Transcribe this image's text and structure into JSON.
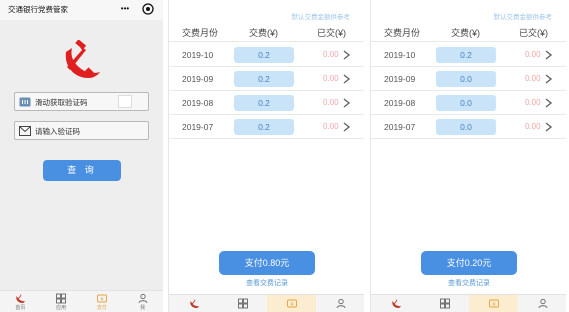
{
  "login_screen": {
    "app_title": "交通银行党费管家",
    "captcha_placeholder": "滑动获取验证码",
    "code_placeholder": "请输入验证码",
    "query_button": "查 询",
    "tabs": [
      {
        "label": "首页",
        "icon": "party-emblem-icon"
      },
      {
        "label": "应用",
        "icon": "grid-icon"
      },
      {
        "label": "支付",
        "icon": "payment-icon",
        "active": true
      },
      {
        "label": "我",
        "icon": "person-icon"
      }
    ]
  },
  "fee_list_1": {
    "notice": "默认交费金额供参考",
    "headers": {
      "month": "交费月份",
      "fee": "交费(¥)",
      "paid": "已交(¥)"
    },
    "rows": [
      {
        "month": "2019-10",
        "fee": "0.2",
        "paid": "0.00"
      },
      {
        "month": "2019-09",
        "fee": "0.2",
        "paid": "0.00"
      },
      {
        "month": "2019-08",
        "fee": "0.2",
        "paid": "0.00"
      },
      {
        "month": "2019-07",
        "fee": "0.2",
        "paid": "0.00"
      }
    ],
    "pay_button": "支付0.80元",
    "record_link": "查看交费记录"
  },
  "fee_list_2": {
    "notice": "默认交费金额供参考",
    "headers": {
      "month": "交费月份",
      "fee": "交费(¥)",
      "paid": "已交(¥)"
    },
    "rows": [
      {
        "month": "2019-10",
        "fee": "0.2",
        "paid": "0.00"
      },
      {
        "month": "2019-09",
        "fee": "0.0",
        "paid": "0.00"
      },
      {
        "month": "2019-08",
        "fee": "0.0",
        "paid": "0.00"
      },
      {
        "month": "2019-07",
        "fee": "0.0",
        "paid": "0.00"
      }
    ],
    "pay_button": "支付0.20元",
    "record_link": "查看交费记录"
  },
  "colors": {
    "primary": "#4a90e2",
    "fee_field": "#c9e3f8",
    "paid_text": "#f2a8a8",
    "emblem": "#e02020",
    "active_tab": "#e6a23c"
  }
}
